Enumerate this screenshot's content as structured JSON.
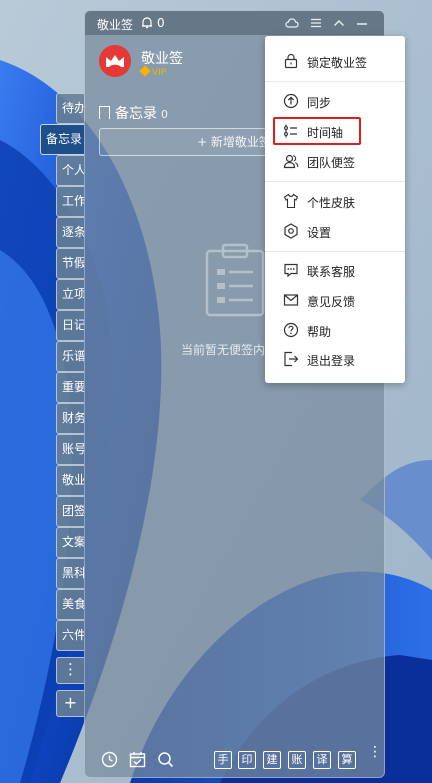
{
  "window": {
    "title": "敬业签",
    "notification_count": "0"
  },
  "user": {
    "name": "敬业签",
    "badge": "VIP"
  },
  "section": {
    "title": "备忘录",
    "count": "0"
  },
  "new_note_label": "+ 新增敬业签",
  "empty_text": "当前暂无便签内容",
  "tabs": [
    {
      "label": "待办"
    },
    {
      "label": "备忘录",
      "active": true
    },
    {
      "label": "个人"
    },
    {
      "label": "工作"
    },
    {
      "label": "逐条"
    },
    {
      "label": "节假"
    },
    {
      "label": "立项"
    },
    {
      "label": "日记"
    },
    {
      "label": "乐谱"
    },
    {
      "label": "重要"
    },
    {
      "label": "财务"
    },
    {
      "label": "账号"
    },
    {
      "label": "敬业"
    },
    {
      "label": "团签"
    },
    {
      "label": "文案"
    },
    {
      "label": "黑科"
    },
    {
      "label": "美食"
    },
    {
      "label": "六件"
    }
  ],
  "tab_controls": {
    "more": "⋮",
    "add": "+"
  },
  "menu": {
    "items": [
      {
        "label": "锁定敬业签",
        "icon": "lock-icon"
      },
      {
        "label": "同步",
        "icon": "sync-icon"
      },
      {
        "label": "时间轴",
        "icon": "timeline-icon",
        "highlighted": true
      },
      {
        "label": "团队便签",
        "icon": "team-icon"
      },
      {
        "label": "个性皮肤",
        "icon": "skin-icon"
      },
      {
        "label": "设置",
        "icon": "settings-icon"
      },
      {
        "label": "联系客服",
        "icon": "chat-icon"
      },
      {
        "label": "意见反馈",
        "icon": "mail-icon"
      },
      {
        "label": "帮助",
        "icon": "help-icon"
      },
      {
        "label": "退出登录",
        "icon": "logout-icon"
      }
    ]
  },
  "bottom_bar": {
    "keys": [
      "手",
      "印",
      "建",
      "账",
      "译",
      "算"
    ],
    "more": "⋮"
  },
  "colors": {
    "avatar": "#e53935",
    "vip": "#f4b400",
    "active_tab": "#1e4f8a",
    "highlight": "#e21b1b"
  }
}
